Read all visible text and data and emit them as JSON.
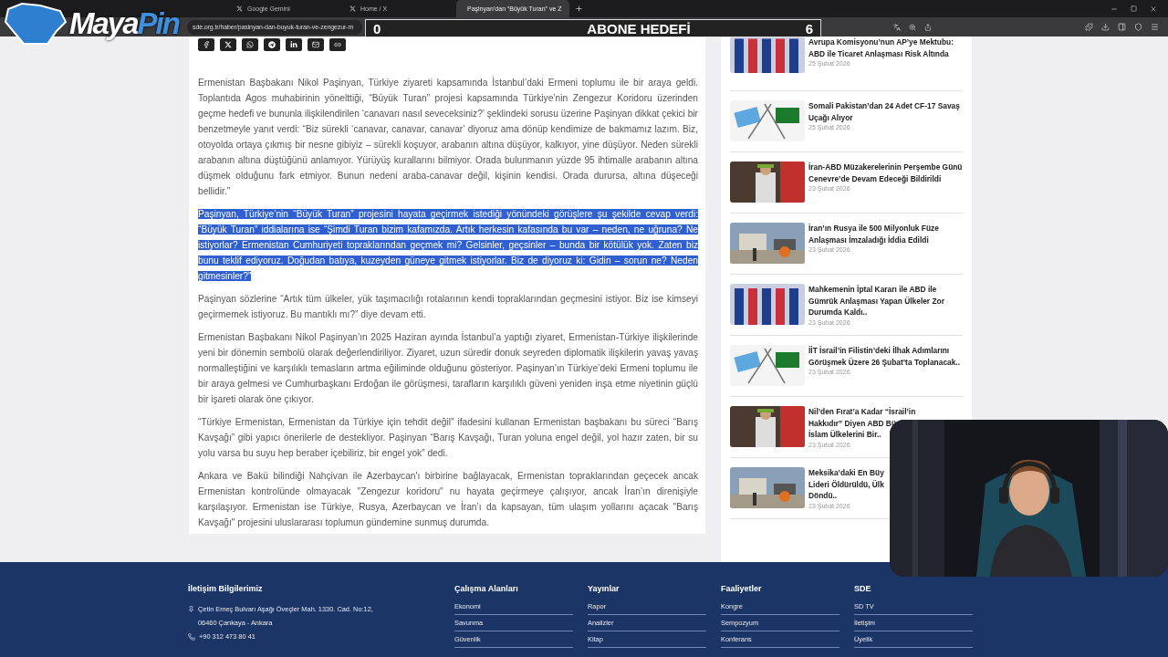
{
  "browser": {
    "tabs": [
      {
        "label": "Google Gemini",
        "selected": false
      },
      {
        "label": "Home / X",
        "selected": false
      },
      {
        "label": "Paşinyan’dan “Büyük Turan” ve Z",
        "selected": true
      }
    ],
    "url": "sde.org.tr/haber/pasinyan-dan-buyuk-turan-ve-zengezur-m"
  },
  "overlay": {
    "logo_text": [
      "Maya",
      "Pin"
    ],
    "goal": {
      "title": "ABONE HEDEFİ",
      "current": "0",
      "target": "6",
      "level": 0
    }
  },
  "article": {
    "paragraphs": [
      {
        "text": "Ermenistan Başbakanı Nikol Paşinyan, Türkiye ziyareti kapsamında İstanbul’daki Ermeni toplumu ile bir araya geldi. Toplantıda Agos muhabirinin yönelttiği, “Büyük Turan” projesi kapsamında Türkiye’nin Zengezur Koridoru üzerinden geçme hedefi ve bununla ilişkilendirilen ‘canavarı nasıl seveceksiniz?’ şeklindeki sorusu üzerine Paşinyan dikkat çekici bir benzetmeyle yanıt verdi: “Biz sürekli ‘canavar, canavar, canavar’ diyoruz ama dönüp kendimize de bakmamız lazım. Biz, otoyolda ortaya çıkmış bir nesne gibiyiz – sürekli koşuyor, arabanın altına düşüyor, kalkıyor, yine düşüyor. Neden sürekli arabanın altına düştüğünü anlamıyor. Yürüyüş kurallarını bilmiyor. Orada bulunmanın yüzde 95 ihtimalle arabanın altına düşmek olduğunu fark etmiyor. Bunun nedeni araba-canavar değil, kişinin kendisi. Orada durursa, altına düşeceği bellidir.”",
        "selected": false
      },
      {
        "text": "Paşinyan, Türkiye’nin “Büyük Turan” projesini hayata geçirmek istediği yönündeki görüşlere şu şekilde cevap verdi: “Büyük Turan” iddialarına ise “Şimdi Turan bizim kafamızda. Artık herkesin kafasında bu var – neden, ne uğruna? Ne istiyorlar? Ermenistan Cumhuriyeti topraklarından geçmek mi? Gelsinler, geçsinler – bunda bir kötülük yok. Zaten biz bunu teklif ediyoruz. Doğudan batıya, kuzeyden güneye gitmek istiyorlar. Biz de diyoruz ki: Gidin – sorun ne? Neden gitmesinler?”",
        "selected": true
      },
      {
        "text": "Paşinyan sözlerine “Artık tüm ülkeler, yük taşımacılığı rotalarının kendi topraklarından geçmesini istiyor. Biz ise kimseyi geçirmemek istiyoruz. Bu mantıklı mı?” diye devam etti.",
        "selected": false
      },
      {
        "text": "Ermenistan Başbakanı Nikol Paşinyan’ın 2025 Haziran ayında İstanbul’a yaptığı ziyaret, Ermenistan-Türkiye ilişkilerinde yeni bir dönemin sembolü olarak değerlendiriliyor. Ziyaret, uzun süredir donuk seyreden diplomatik ilişkilerin yavaş yavaş normalleştiğini ve karşılıklı temasların artma eğiliminde olduğunu gösteriyor. Paşinyan’ın Türkiye’deki Ermeni toplumu ile bir araya gelmesi ve Cumhurbaşkanı Erdoğan ile görüşmesi, tarafların karşılıklı güveni yeniden inşa etme niyetinin güçlü bir işareti olarak öne çıkıyor.",
        "selected": false
      },
      {
        "text": "“Türkiye Ermenistan, Ermenistan da Türkiye için tehdit değil” ifadesini kullanan Ermenistan başbakanı bu süreci “Barış Kavşağı” gibi yapıcı önerilerle de destekliyor. Paşinyan “Barış Kavşağı, Turan yoluna engel değil, yol hazır zaten, bir su yolu varsa bu suyu hep beraber içebiliriz, bir engel yok” dedi.",
        "selected": false
      },
      {
        "text": "Ankara ve Bakü  bilindiği Nahçivan ile Azerbaycan'ı birbirine bağlayacak, Ermenistan topraklarından geçecek ancak Ermenistan kontrolünde olmayacak \"Zengezur koridoru\" nu hayata geçirmeye çalışıyor, ancak İran’ın direnişiyle karşılaşıyor. Ermenistan ise Türkiye, Rusya, Azerbaycan ve İran’ı da kapsayan, tüm ulaşım yollarını açacak \"Barış Kavşağı\" projesini uluslararası toplumun gündemine sunmuş durumda.",
        "selected": false
      }
    ]
  },
  "sidebar": {
    "items": [
      {
        "title": "Avrupa Komisyonu’nun AP’ye Mektubu: ABD ile Ticaret Anlaşması Risk Altında",
        "date": "25 Şubat 2026"
      },
      {
        "title": "Somali Pakistan’dan 24 Adet CF-17 Savaş Uçağı Alıyor",
        "date": "25 Şubat 2026"
      },
      {
        "title": "İran-ABD Müzakerelerinin Perşembe Günü Cenevre’de Devam Edeceği Bildirildi",
        "date": "23 Şubat 2026"
      },
      {
        "title": "İran’ın Rusya ile 500 Milyonluk Füze Anlaşması İmzaladığı İddia Edildi",
        "date": "23 Şubat 2026"
      },
      {
        "title": "Mahkemenin İptal Kararı ile ABD ile Gümrük Anlaşması Yapan Ülkeler Zor Durumda Kaldı..",
        "date": "23 Şubat 2026"
      },
      {
        "title": "İİT İsrail’in Filistin’deki İlhak Adımlarını Görüşmek Üzere 26 Şubat’ta Toplanacak..",
        "date": "23 Şubat 2026"
      },
      {
        "title": "Nil’den Fırat’a Kadar “İsrail’in\nHakkıdır” Diyen ABD Bü\nİslam Ülkelerini Bir..",
        "date": "23 Şubat 2026"
      },
      {
        "title": "Meksika’daki En Büy\nLideri Öldürüldü, Ülk\nDöndü..",
        "date": "23 Şubat 2026"
      }
    ]
  },
  "footer": {
    "contact": {
      "title": "İletişim Bilgilerimiz",
      "address": "Çetin Emeç Bulvarı Aşağı Öveçler Mah. 1330. Cad. No:12, 06460 Çankaya - Ankara",
      "phone": "+90 312 473 80 41"
    },
    "columns": [
      {
        "title": "Çalışma Alanları",
        "links": [
          "Ekonomi",
          "Savunma",
          "Güvenlik"
        ]
      },
      {
        "title": "Yayınlar",
        "links": [
          "Rapor",
          "Analizler",
          "Kitap"
        ]
      },
      {
        "title": "Faaliyetler",
        "links": [
          "Kongre",
          "Sempozyum",
          "Konferans"
        ]
      },
      {
        "title": "SDE",
        "links": [
          "SD TV",
          "İletişim",
          "Üyelik"
        ]
      }
    ]
  }
}
